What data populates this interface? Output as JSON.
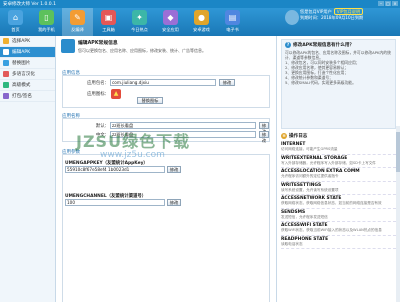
{
  "window": {
    "title": "安卓修改大师 Ver 1.0.0.1"
  },
  "toolbar": {
    "items": [
      {
        "label": "首页",
        "color": "#4aa3df"
      },
      {
        "label": "我的手机",
        "color": "#5cc15c"
      },
      {
        "label": "反编译",
        "color": "#f39c33"
      },
      {
        "label": "工具箱",
        "color": "#e45757"
      },
      {
        "label": "今日热点",
        "color": "#3cb6a8"
      },
      {
        "label": "安全应用",
        "color": "#9a6fd6"
      },
      {
        "label": "安卓游戏",
        "color": "#e0a52b"
      },
      {
        "label": "电子书",
        "color": "#4f86e0"
      }
    ]
  },
  "ad": {
    "line1": "您是包月VIP用户",
    "badge": "VIP包月说明",
    "line2": "到期时间：2018年09月10日到期"
  },
  "sidebar": {
    "items": [
      {
        "label": "选择APK",
        "color": "#f0b030",
        "active": false
      },
      {
        "label": "编辑APK",
        "color": "#ffffff",
        "active": true
      },
      {
        "label": "替换图片",
        "color": "#3aa0e0",
        "active": false
      },
      {
        "label": "多语言汉化",
        "color": "#e25a5a",
        "active": false
      },
      {
        "label": "高级模式",
        "color": "#2fb87f",
        "active": false
      },
      {
        "label": "打包/签名",
        "color": "#8866cc",
        "active": false
      }
    ]
  },
  "main": {
    "title": "编辑APK常规信息",
    "desc": "您可以更换包名、应用名称、应用图标，修改安装、统计、广告等信息。",
    "section_app": "应用信息",
    "package_label": "应用包名：",
    "package_value": "com.jiuliang.djxiu",
    "modify_btn": "修改",
    "icon_label": "应用图标：",
    "replace_icon_btn": "替换图标",
    "section_name": "应用名称",
    "default_label": "默认：",
    "default_value": "zz班长看盘",
    "zh_label": "中文：",
    "zh_value": "zz班长看盘",
    "section_param": "应用参数",
    "p1_title": "UMENGAPPKEY（友盟统计AppKey）",
    "p1_value": "55910c8f67e58ef4 1b0023d1",
    "p2_title": "UMENGCHANNEL（友盟统计渠道号）",
    "p2_value": "100",
    "watermark": "JZSU绿色下载",
    "watermark_url": "www.jz5u.com"
  },
  "right": {
    "tip_title": "修改APK常规信息有什么用？",
    "tip_lines": [
      "可以修改APK的包名、应用名称及图标，并可以修改APK内的统计、渠道等参数信息。",
      "1、修改包名，可以同时安装多个相同应用；",
      "2、修改应用名称，使其更容易辨认；",
      "3、更换应用图标，打造个性化应用；",
      "4、修改统计参数和渠道号；",
      "5、修改SMALI代码，实现更多高级功能。"
    ],
    "log_title": "操作日志",
    "perms": [
      {
        "name": "INTERNET",
        "desc": "访问网络连接，可能产生GPRS流量"
      },
      {
        "name": "WRITEEXTERNAL STORAGE",
        "desc": "写入外部存储器，允许程序写入外部存储，如SD卡上写文件"
      },
      {
        "name": "ACCESSLOCATION EXTRA COMM",
        "desc": "允许程序访问额外的定位提供者指令"
      },
      {
        "name": "WRITESETTINGS",
        "desc": "读写系统设置，允许读写系统设置项"
      },
      {
        "name": "ACCESSNETWORK STATE",
        "desc": "获取网络状态，获取网络信息状态，如当前的网络连接是否有效"
      },
      {
        "name": "SENDSMS",
        "desc": "发送短信，允许程序发送短信"
      },
      {
        "name": "ACCESSWIFI STATE",
        "desc": "获取WiFi状态，获取当前WiFi接入的状态以及WLAN热点的信息"
      },
      {
        "name": "READPHONE STATE",
        "desc": "读取电话状态"
      }
    ]
  }
}
